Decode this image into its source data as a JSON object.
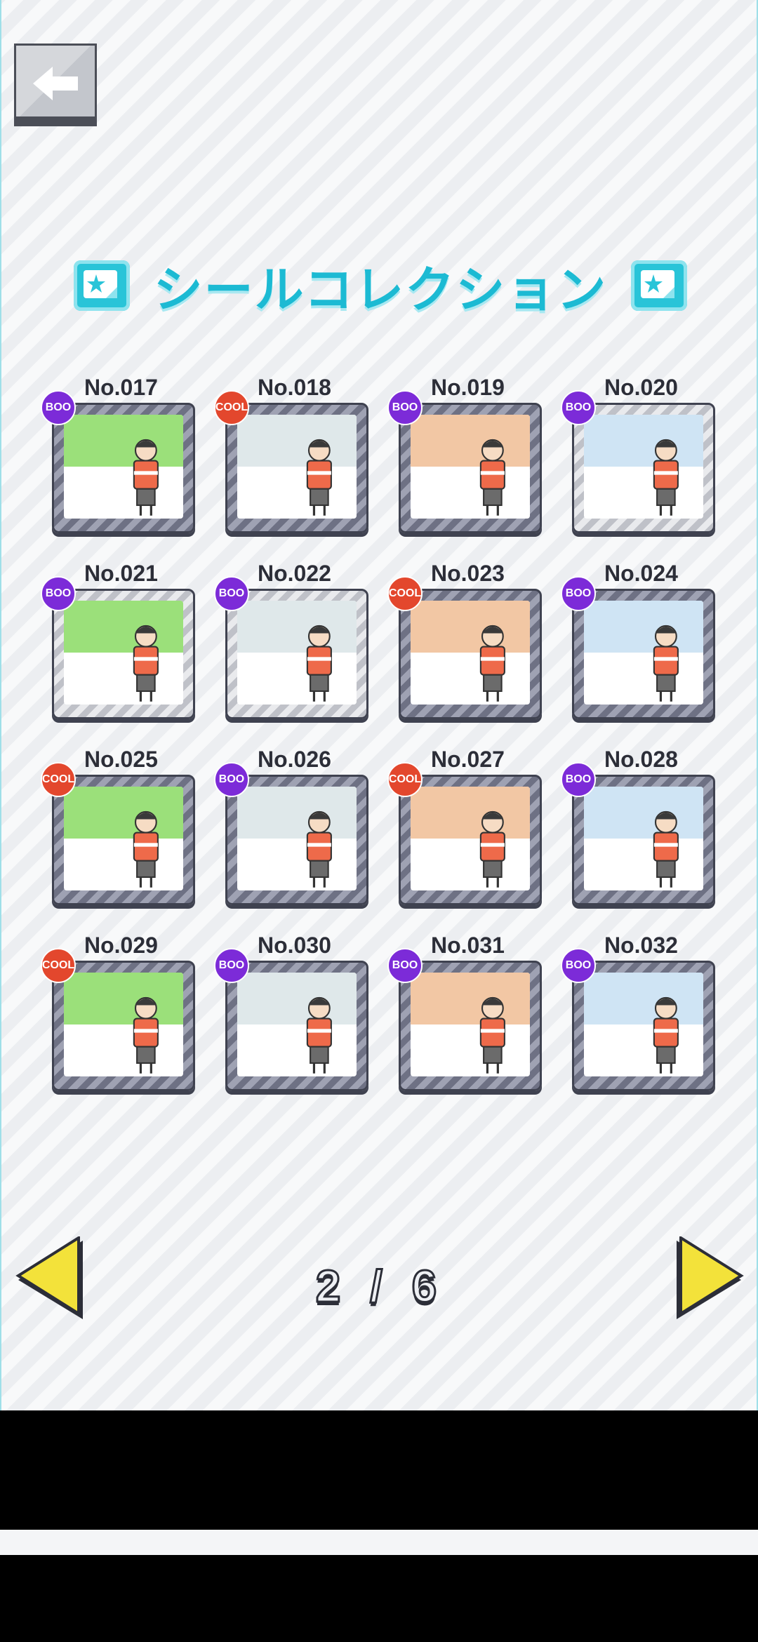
{
  "header": {
    "back_label": "back"
  },
  "title": "シールコレクション",
  "cards": [
    {
      "number": "No.017",
      "tag": "BOO",
      "frame": "gray"
    },
    {
      "number": "No.018",
      "tag": "COOL",
      "frame": "gray"
    },
    {
      "number": "No.019",
      "tag": "BOO",
      "frame": "gray"
    },
    {
      "number": "No.020",
      "tag": "BOO",
      "frame": "silver"
    },
    {
      "number": "No.021",
      "tag": "BOO",
      "frame": "silver"
    },
    {
      "number": "No.022",
      "tag": "BOO",
      "frame": "silver"
    },
    {
      "number": "No.023",
      "tag": "COOL",
      "frame": "gray"
    },
    {
      "number": "No.024",
      "tag": "BOO",
      "frame": "gray"
    },
    {
      "number": "No.025",
      "tag": "COOL",
      "frame": "gray"
    },
    {
      "number": "No.026",
      "tag": "BOO",
      "frame": "gray"
    },
    {
      "number": "No.027",
      "tag": "COOL",
      "frame": "gray"
    },
    {
      "number": "No.028",
      "tag": "BOO",
      "frame": "gray"
    },
    {
      "number": "No.029",
      "tag": "COOL",
      "frame": "gray"
    },
    {
      "number": "No.030",
      "tag": "BOO",
      "frame": "gray"
    },
    {
      "number": "No.031",
      "tag": "BOO",
      "frame": "gray"
    },
    {
      "number": "No.032",
      "tag": "BOO",
      "frame": "gray"
    }
  ],
  "pager": {
    "text": "2 / 6",
    "current": 2,
    "total": 6
  },
  "colors": {
    "accent": "#1cbad3",
    "boo": "#7c2bd8",
    "cool": "#e3472d",
    "arrow": "#f3e23a"
  }
}
